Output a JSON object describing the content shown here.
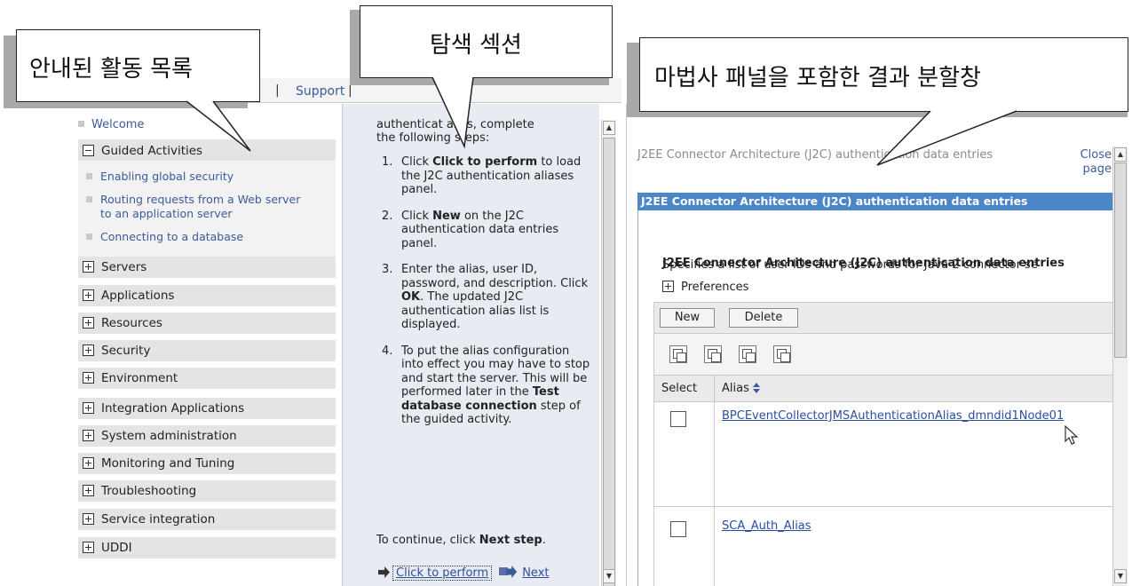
{
  "callouts": {
    "guided_list": "안내된 활동 목록",
    "navigation": "탐색 섹션",
    "results_pane": "마법사 패널을 포함한 결과 분할창"
  },
  "topbar": {
    "about_fragment": "ut",
    "separator": "|",
    "support": "Support"
  },
  "nav": {
    "welcome": "Welcome",
    "guided_activities": "Guided Activities",
    "guided_items": [
      "Enabling global security",
      "Routing requests from a Web server to an application server",
      "Connecting to a database"
    ],
    "items": [
      "Servers",
      "Applications",
      "Resources",
      "Security",
      "Environment",
      "Integration Applications",
      "System administration",
      "Monitoring and Tuning",
      "Troubleshooting",
      "Service integration",
      "UDDI"
    ]
  },
  "help": {
    "intro_line1": "authenticat  alias, complete",
    "intro_line2": "the following steps:",
    "steps": [
      {
        "num": "1.",
        "parts": [
          "Click ",
          "Click to perform",
          " to load the J2C authentication aliases panel."
        ]
      },
      {
        "num": "2.",
        "parts": [
          "Click ",
          "New",
          " on the J2C authentication data entries panel."
        ]
      },
      {
        "num": "3.",
        "parts": [
          "Enter the alias, user ID, password, and description. Click ",
          "OK",
          ". The updated J2C authentication alias list is displayed."
        ]
      },
      {
        "num": "4.",
        "parts": [
          "To put the alias configuration into effect you may have to stop and start the server. This will be performed later in the ",
          "Test database connection",
          " step of the guided activity."
        ]
      }
    ],
    "continue_prefix": "To continue, click ",
    "continue_bold": "Next step",
    "continue_suffix": ".",
    "perform_link": "Click to perform",
    "next_link": "Next"
  },
  "results": {
    "header": "J2EE Connector Architecture (J2C) authentication data entries",
    "close_page": "Close page",
    "bar_title": "J2EE Connector Architecture (J2C) authentication data entries",
    "title": "J2EE Connector Architecture (J2C) authentication data entries",
    "description": "Specifies a list of user IDs and passwords for Java 2 connector se",
    "preferences": "Preferences",
    "new_button": "New",
    "delete_button": "Delete",
    "col_select": "Select",
    "col_alias": "Alias",
    "rows": [
      "BPCEventCollectorJMSAuthenticationAlias_dmndid1Node01",
      "SCA_Auth_Alias"
    ]
  }
}
